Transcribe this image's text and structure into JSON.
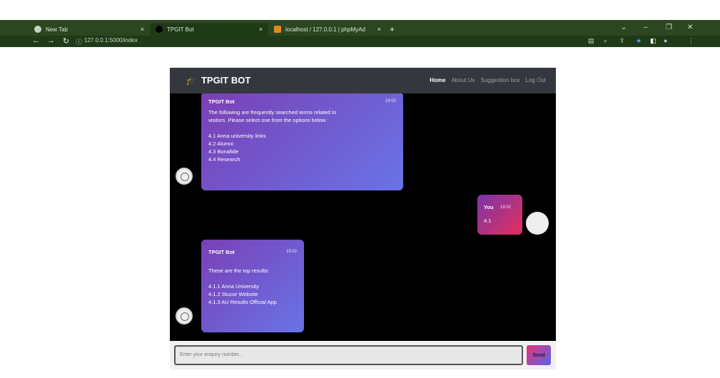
{
  "browser": {
    "tabs": [
      {
        "label": "New Tab",
        "close": "×"
      },
      {
        "label": "TPGIT Bot",
        "close": "×"
      },
      {
        "label": "localhost / 127.0.0.1 | phpMyAd⁠",
        "close": "×"
      }
    ],
    "new_tab": "+",
    "url": "127.0.0.1:5000/index"
  },
  "app": {
    "brand": "TPGIT BOT",
    "nav": [
      "Home",
      "About Us",
      "Suggestion box",
      "Log Out"
    ]
  },
  "messages": [
    {
      "sender": "TPGIT Bot",
      "time": "19:02",
      "lines": [
        "The following are frequently searched terms related to",
        "visitors. Please select one from the options below :",
        "",
        "4.1 Anna university links",
        "4.2 Alumni",
        "4.3 Bonafide",
        "4.4 Research"
      ]
    },
    {
      "sender": "You",
      "time": "19:02",
      "lines": [
        "4.1"
      ]
    },
    {
      "sender": "TPGIT Bot",
      "time": "19:02",
      "lines": [
        "",
        "These are the top results:",
        "",
        "4.1.1 Anna University",
        "4.1.2 Stucor Website",
        "4.1.3 AU Results Official App"
      ]
    }
  ],
  "composer": {
    "placeholder": "Enter your enquiry number...",
    "send_label": "Send"
  },
  "colors": {
    "header": "#34373d",
    "chat_bg": "#000000",
    "bot_bubble": "#6874e6",
    "user_bubble": "#e3305d"
  }
}
